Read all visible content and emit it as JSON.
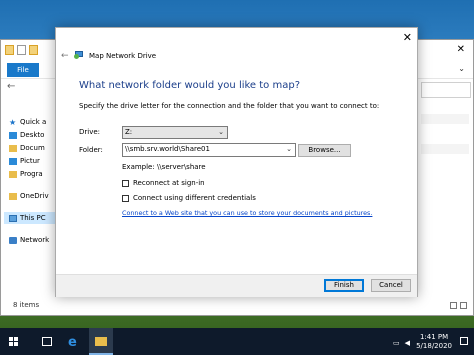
{
  "explorer": {
    "ribbon": {
      "file_tab": "File"
    },
    "nav_items": [
      {
        "label": "Quick a",
        "icon": "star-icon"
      },
      {
        "label": "Deskto",
        "icon": "desktop-icon"
      },
      {
        "label": "Docum",
        "icon": "documents-icon"
      },
      {
        "label": "Pictur",
        "icon": "pictures-icon"
      },
      {
        "label": "Progra",
        "icon": "folder-icon"
      },
      {
        "label": "OneDriv",
        "icon": "onedrive-icon"
      },
      {
        "label": "This PC",
        "icon": "this-pc-icon"
      },
      {
        "label": "Network",
        "icon": "network-icon"
      }
    ],
    "status": "8 items"
  },
  "dialog": {
    "title": "Map Network Drive",
    "heading": "What network folder would you like to map?",
    "description": "Specify the drive letter for the connection and the folder that you want to connect to:",
    "drive_label": "Drive:",
    "drive_value": "Z:",
    "folder_label": "Folder:",
    "folder_value": "\\\\smb.srv.world\\Share01",
    "browse_label": "Browse...",
    "example": "Example: \\\\server\\share",
    "reconnect_label": "Reconnect at sign-in",
    "reconnect_checked": false,
    "credentials_label": "Connect using different credentials",
    "credentials_checked": false,
    "link_text": "Connect to a Web site that you can use to store your documents and pictures.",
    "finish_label": "Finish",
    "cancel_label": "Cancel",
    "close_glyph": "✕",
    "back_glyph": "←"
  },
  "taskbar": {
    "time": "1:41 PM",
    "date": "5/18/2020",
    "accent": "#0e1a2b"
  }
}
